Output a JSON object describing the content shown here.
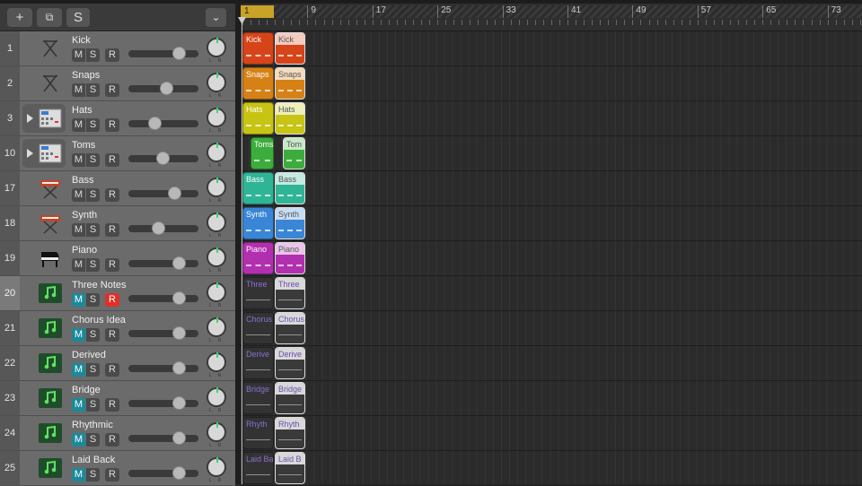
{
  "toolbar": {
    "add_label": "+",
    "duplicate_label": "⧉",
    "s_label": "S",
    "collapse_label": "⌄"
  },
  "ruler": {
    "bars": [
      "1",
      "9",
      "17",
      "25",
      "33",
      "41",
      "49",
      "57",
      "65",
      "73"
    ]
  },
  "track_buttons": {
    "mute": "M",
    "solo": "S",
    "record": "R"
  },
  "tracks": [
    {
      "num": "1",
      "name": "Kick",
      "icon": "drum-stand-icon",
      "volume": 0.72,
      "color": "#d64419",
      "region": "Kick",
      "muted": false,
      "record": false,
      "folder": false
    },
    {
      "num": "2",
      "name": "Snaps",
      "icon": "drum-stand-icon",
      "volume": 0.54,
      "color": "#d68116",
      "region": "Snaps",
      "muted": false,
      "record": false,
      "folder": false
    },
    {
      "num": "3",
      "name": "Hats",
      "icon": "drum-machine-icon",
      "volume": 0.37,
      "color": "#c7c414",
      "region": "Hats",
      "muted": false,
      "record": false,
      "folder": true
    },
    {
      "num": "10",
      "name": "Toms",
      "icon": "drum-machine-icon",
      "volume": 0.49,
      "color": "#3cad3c",
      "region": "Toms",
      "region2": "Tom",
      "muted": false,
      "record": false,
      "folder": true
    },
    {
      "num": "17",
      "name": "Bass",
      "icon": "keyboard-icon",
      "volume": 0.65,
      "color": "#2fb596",
      "region": "Bass",
      "muted": false,
      "record": false,
      "folder": false
    },
    {
      "num": "18",
      "name": "Synth",
      "icon": "keyboard-icon",
      "volume": 0.42,
      "color": "#3a86d6",
      "region": "Synth",
      "muted": false,
      "record": false,
      "folder": false
    },
    {
      "num": "19",
      "name": "Piano",
      "icon": "piano-icon",
      "volume": 0.72,
      "color": "#b22fb0",
      "region": "Piano",
      "muted": false,
      "record": false,
      "folder": false
    },
    {
      "num": "20",
      "name": "Three Notes",
      "icon": "music-note-icon",
      "volume": 0.72,
      "color": "#3c3c3c",
      "region": "Three",
      "muted": true,
      "record": true,
      "folder": false
    },
    {
      "num": "21",
      "name": "Chorus Idea",
      "icon": "music-note-icon",
      "volume": 0.72,
      "color": "#3c3c3c",
      "region": "Chorus",
      "muted": true,
      "record": false,
      "folder": false
    },
    {
      "num": "22",
      "name": "Derived",
      "icon": "music-note-icon",
      "volume": 0.72,
      "color": "#3c3c3c",
      "region": "Derive",
      "muted": true,
      "record": false,
      "folder": false
    },
    {
      "num": "23",
      "name": "Bridge",
      "icon": "music-note-icon",
      "volume": 0.72,
      "color": "#3c3c3c",
      "region": "Bridge",
      "muted": true,
      "record": false,
      "folder": false
    },
    {
      "num": "24",
      "name": "Rhythmic",
      "icon": "music-note-icon",
      "volume": 0.72,
      "color": "#3c3c3c",
      "region": "Rhyth",
      "muted": true,
      "record": false,
      "folder": false
    },
    {
      "num": "25",
      "name": "Laid Back",
      "icon": "music-note-icon",
      "volume": 0.72,
      "color": "#3c3c3c",
      "region": "Laid Ba",
      "region2": "Laid B",
      "muted": true,
      "record": false,
      "folder": false
    }
  ],
  "selected_track": "20",
  "colors": {
    "accent": "#c9a228",
    "mute_on": "#1a8a9a",
    "record_on": "#e0302a"
  }
}
